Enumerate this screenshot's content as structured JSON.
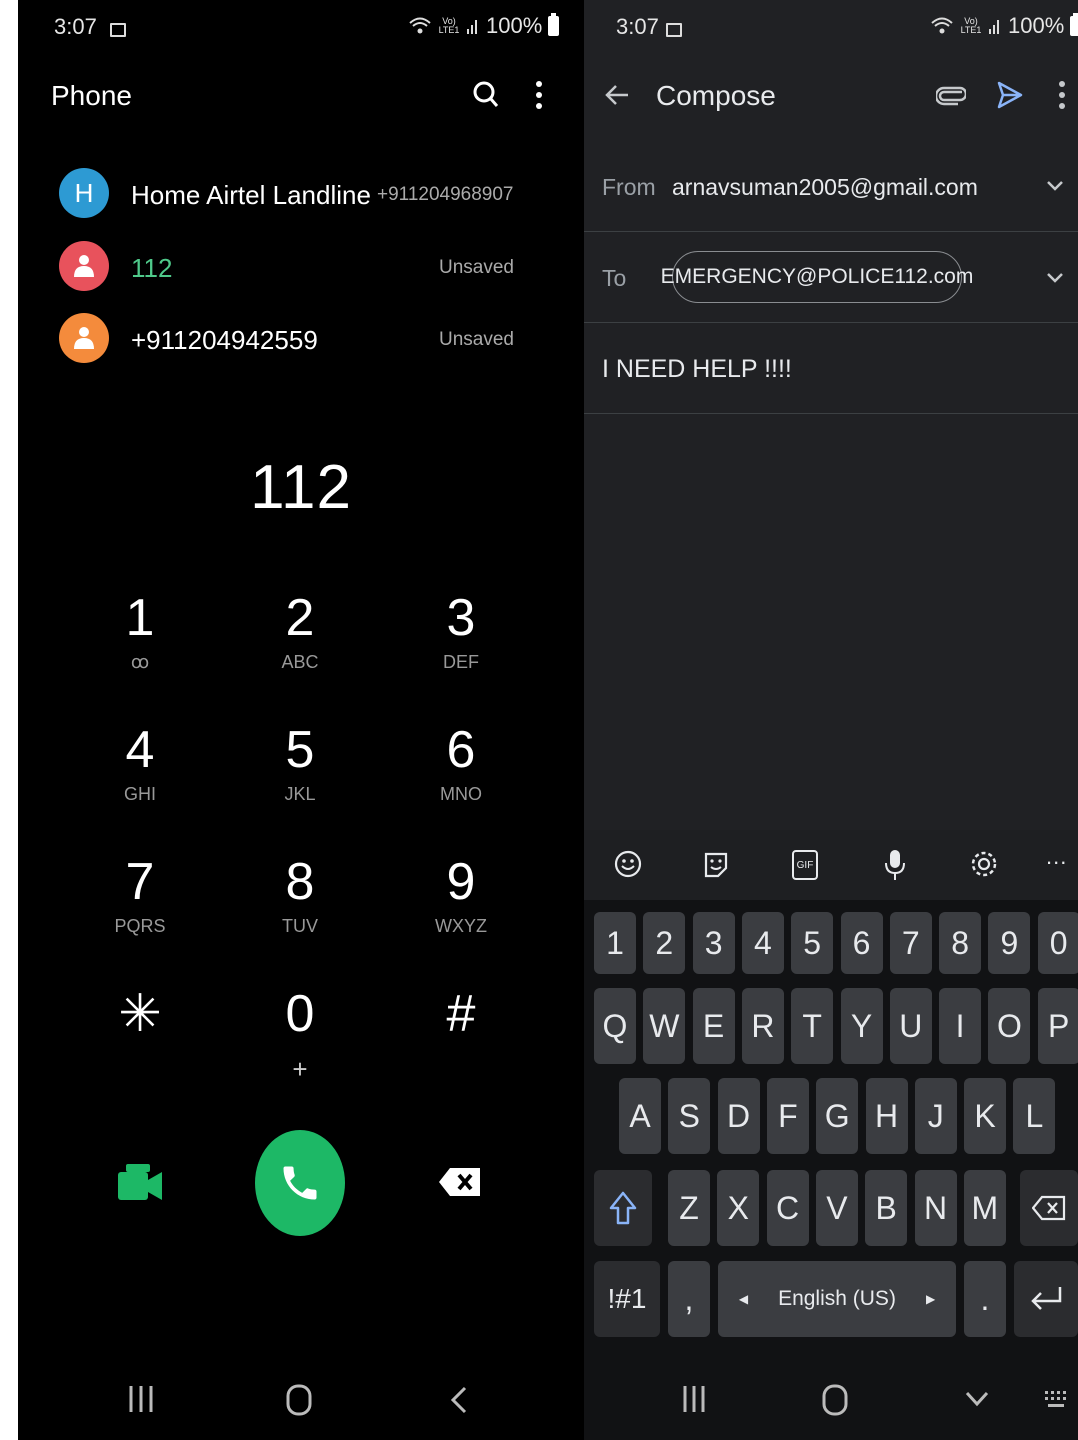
{
  "left": {
    "status": {
      "time": "3:07",
      "battery": "100%",
      "net": "Vo) LTE1"
    },
    "header": {
      "title": "Phone"
    },
    "contacts": [
      {
        "initial": "H",
        "name": "Home Airtel Landline",
        "number": "+911204968907",
        "color": "#2d9ad3"
      },
      {
        "initial": "",
        "name": "112",
        "number": "Unsaved",
        "color": "#e8525c"
      },
      {
        "initial": "",
        "name": "+911204942559",
        "number": "Unsaved",
        "color": "#f48b3c"
      }
    ],
    "dialed": "112",
    "keys": [
      {
        "d": "1",
        "l": "ꝏ"
      },
      {
        "d": "2",
        "l": "ABC"
      },
      {
        "d": "3",
        "l": "DEF"
      },
      {
        "d": "4",
        "l": "GHI"
      },
      {
        "d": "5",
        "l": "JKL"
      },
      {
        "d": "6",
        "l": "MNO"
      },
      {
        "d": "7",
        "l": "PQRS"
      },
      {
        "d": "8",
        "l": "TUV"
      },
      {
        "d": "9",
        "l": "WXYZ"
      },
      {
        "d": "✳",
        "l": ""
      },
      {
        "d": "0",
        "l": "+"
      },
      {
        "d": "#",
        "l": ""
      }
    ],
    "colors": {
      "call": "#1db866",
      "video": "#1db866"
    }
  },
  "right": {
    "status": {
      "time": "3:07",
      "battery": "100%",
      "net": "Vo) LTE1"
    },
    "header": {
      "title": "Compose"
    },
    "from_label": "From",
    "from_value": "arnavsuman2005@gmail.com",
    "to_label": "To",
    "to_value": "EMERGENCY@POLICE112.com",
    "body": "I NEED HELP !!!!",
    "keyboard": {
      "row_numbers": [
        "1",
        "2",
        "3",
        "4",
        "5",
        "6",
        "7",
        "8",
        "9",
        "0"
      ],
      "row1": [
        "Q",
        "W",
        "E",
        "R",
        "T",
        "Y",
        "U",
        "I",
        "O",
        "P"
      ],
      "row2": [
        "A",
        "S",
        "D",
        "F",
        "G",
        "H",
        "J",
        "K",
        "L"
      ],
      "row3": [
        "Z",
        "X",
        "C",
        "V",
        "B",
        "N",
        "M"
      ],
      "symbols": "!#1",
      "comma": ",",
      "space": "English (US)",
      "period": ".",
      "gif": "GIF",
      "more": "..."
    },
    "colors": {
      "accent": "#8ab4f8"
    }
  }
}
